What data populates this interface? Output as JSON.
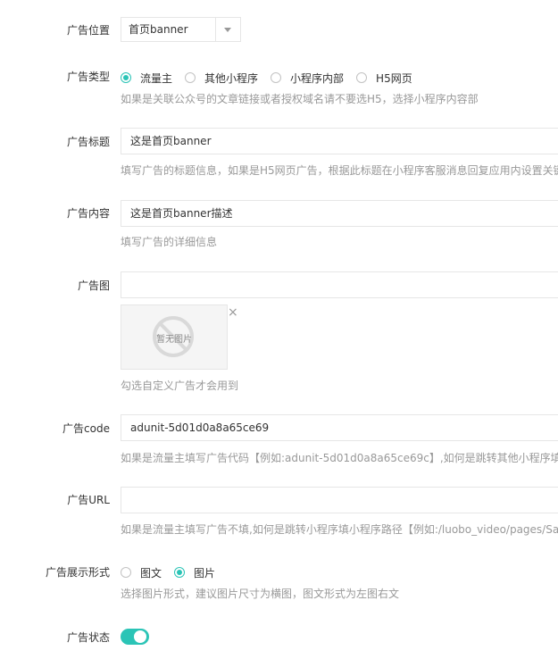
{
  "ad_position": {
    "label": "广告位置",
    "selected": "首页banner"
  },
  "ad_type": {
    "label": "广告类型",
    "options": [
      "流量主",
      "其他小程序",
      "小程序内部",
      "H5网页"
    ],
    "selected_index": 0,
    "help": "如果是关联公众号的文章链接或者授权域名请不要选H5，选择小程序内容部"
  },
  "ad_title": {
    "label": "广告标题",
    "value": "这是首页banner",
    "help": "填写广告的标题信息，如果是H5网页广告，根据此标题在小程序客服消息回复应用内设置关键"
  },
  "ad_content": {
    "label": "广告内容",
    "value": "这是首页banner描述",
    "help": "填写广告的详细信息"
  },
  "ad_image": {
    "label": "广告图",
    "value": "",
    "placeholder_text": "暂无图片",
    "remove_symbol": "×",
    "help": "勾选自定义广告才会用到"
  },
  "ad_code": {
    "label": "广告code",
    "value": "adunit-5d01d0a8a65ce69",
    "help": "如果是流量主填写广告代码【例如:adunit-5d01d0a8a65ce69c】,如何是跳转其他小程序填小程"
  },
  "ad_url": {
    "label": "广告URL",
    "value": "",
    "help": "如果是流量主填写广告不填,如何是跳转小程序填小程序路径【例如:/luobo_video/pages/Satin"
  },
  "ad_display": {
    "label": "广告展示形式",
    "options": [
      "图文",
      "图片"
    ],
    "selected_index": 1,
    "help": "选择图片形式，建议图片尺寸为横图，图文形式为左图右文"
  },
  "ad_status": {
    "label": "广告状态",
    "on": true
  },
  "colors": {
    "accent": "#2bc4b6",
    "help_text": "#999999",
    "border": "#e6e6e6"
  }
}
